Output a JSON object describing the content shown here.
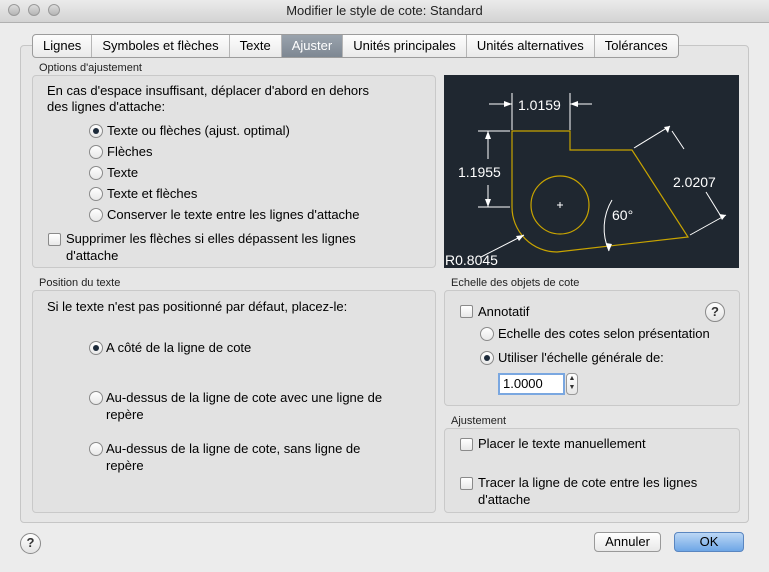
{
  "window": {
    "title": "Modifier le style de cote: Standard"
  },
  "tabs": [
    {
      "label": "Lignes",
      "active": false
    },
    {
      "label": "Symboles et flèches",
      "active": false
    },
    {
      "label": "Texte",
      "active": false
    },
    {
      "label": "Ajuster",
      "active": true
    },
    {
      "label": "Unités principales",
      "active": false
    },
    {
      "label": "Unités alternatives",
      "active": false
    },
    {
      "label": "Tolérances",
      "active": false
    }
  ],
  "fit_options": {
    "title": "Options d'ajustement",
    "intro_line1": "En cas d'espace insuffisant, déplacer d'abord en dehors",
    "intro_line2": "des lignes d'attache:",
    "radios": [
      {
        "label": "Texte ou flèches (ajust. optimal)",
        "selected": true
      },
      {
        "label": "Flèches",
        "selected": false
      },
      {
        "label": "Texte",
        "selected": false
      },
      {
        "label": "Texte et flèches",
        "selected": false
      },
      {
        "label": "Conserver le texte entre les lignes d'attache",
        "selected": false
      }
    ],
    "suppress_line1": "Supprimer les flèches si elles dépassent les lignes",
    "suppress_line2": "d'attache",
    "suppress_checked": false
  },
  "preview": {
    "dim_top": "1.0159",
    "dim_left": "1.1955",
    "dim_right": "2.0207",
    "angle": "60°",
    "radius": "R0.8045",
    "bg_color": "#1f2730",
    "shape_color": "#c8a400"
  },
  "text_position": {
    "title": "Position du texte",
    "intro": "Si le texte n'est pas positionné par défaut, placez-le:",
    "opt1": "A côté de la ligne de cote",
    "opt2_line1": "Au-dessus de la ligne de cote avec une ligne de",
    "opt2_line2": "repère",
    "opt3_line1": "Au-dessus de la ligne de cote, sans ligne de",
    "opt3_line2": "repère",
    "selected_index": 0
  },
  "scale": {
    "title": "Echelle des objets de cote",
    "annotative_label": "Annotatif",
    "annotative_checked": false,
    "layout_label": "Echelle des cotes selon présentation",
    "overall_label": "Utiliser l'échelle générale de:",
    "overall_selected": true,
    "value": "1.0000",
    "help_icon": "?"
  },
  "fine_tuning": {
    "title": "Ajustement",
    "manual_label": "Placer le texte manuellement",
    "manual_checked": false,
    "draw_line1": "Tracer la ligne de cote entre les lignes",
    "draw_line2": "d'attache",
    "draw_checked": false
  },
  "footer": {
    "help_icon": "?",
    "cancel": "Annuler",
    "ok": "OK"
  },
  "colors": {
    "accent": "#6ea6e6",
    "tab_active": "#8a939d"
  }
}
